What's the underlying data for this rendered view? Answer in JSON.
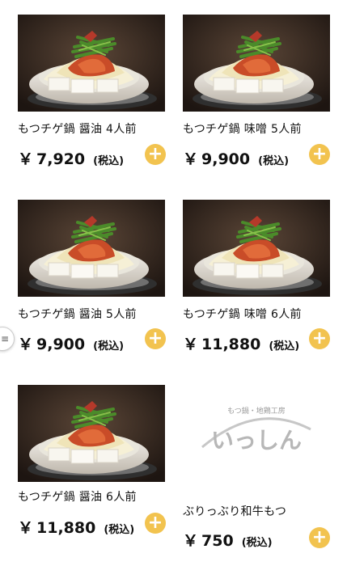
{
  "products": [
    {
      "name": "もつチゲ鍋 醤油 4人前",
      "price": "7,920",
      "tax": "(税込)"
    },
    {
      "name": "もつチゲ鍋 味噌 5人前",
      "price": "9,900",
      "tax": "(税込)"
    },
    {
      "name": "もつチゲ鍋 醤油 5人前",
      "price": "9,900",
      "tax": "(税込)"
    },
    {
      "name": "もつチゲ鍋 味噌 6人前",
      "price": "11,880",
      "tax": "(税込)"
    },
    {
      "name": "もつチゲ鍋 醤油 6人前",
      "price": "11,880",
      "tax": "(税込)"
    },
    {
      "name": "ぶりっぶり和牛もつ",
      "price": "750",
      "tax": "(税込)"
    }
  ],
  "currency_symbol": "￥",
  "add_symbol": "+",
  "logo": {
    "top_text": "もつ鍋・地鶏工房",
    "main_text": "いっしん"
  },
  "menu_icon": "hamburger-icon",
  "colors": {
    "add_button": "#f2c34f"
  }
}
